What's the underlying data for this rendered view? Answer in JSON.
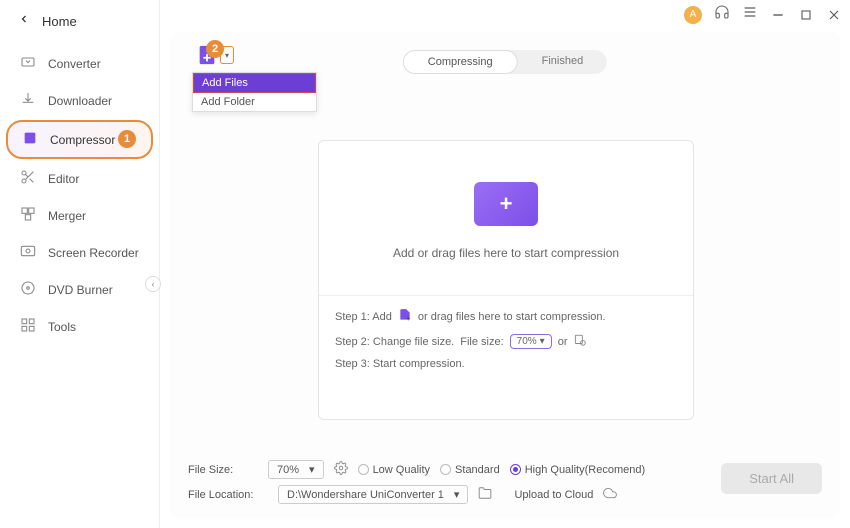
{
  "titlebar": {
    "avatar_initial": "A"
  },
  "sidebar": {
    "title": "Home",
    "items": [
      {
        "label": "Converter"
      },
      {
        "label": "Downloader"
      },
      {
        "label": "Compressor"
      },
      {
        "label": "Editor"
      },
      {
        "label": "Merger"
      },
      {
        "label": "Screen Recorder"
      },
      {
        "label": "DVD Burner"
      },
      {
        "label": "Tools"
      }
    ]
  },
  "annotations": {
    "badge1": "1",
    "badge2": "2"
  },
  "dropdown": {
    "add_files": "Add Files",
    "add_folder": "Add Folder"
  },
  "tabs": {
    "compressing": "Compressing",
    "finished": "Finished"
  },
  "dropzone": {
    "text": "Add or drag files here to start compression",
    "step1_pre": "Step 1: Add",
    "step1_post": "or drag files here to start compression.",
    "step2_pre": "Step 2: Change file size.",
    "step2_filesize": "File size:",
    "step2_value": "70%",
    "step2_or": "or",
    "step3": "Step 3: Start compression."
  },
  "bottom": {
    "file_size_label": "File Size:",
    "file_size_value": "70%",
    "quality": {
      "low": "Low Quality",
      "standard": "Standard",
      "high": "High Quality(Recomend)"
    },
    "file_location_label": "File Location:",
    "file_location_value": "D:\\Wondershare UniConverter 1",
    "upload_cloud": "Upload to Cloud",
    "start_all": "Start All"
  }
}
